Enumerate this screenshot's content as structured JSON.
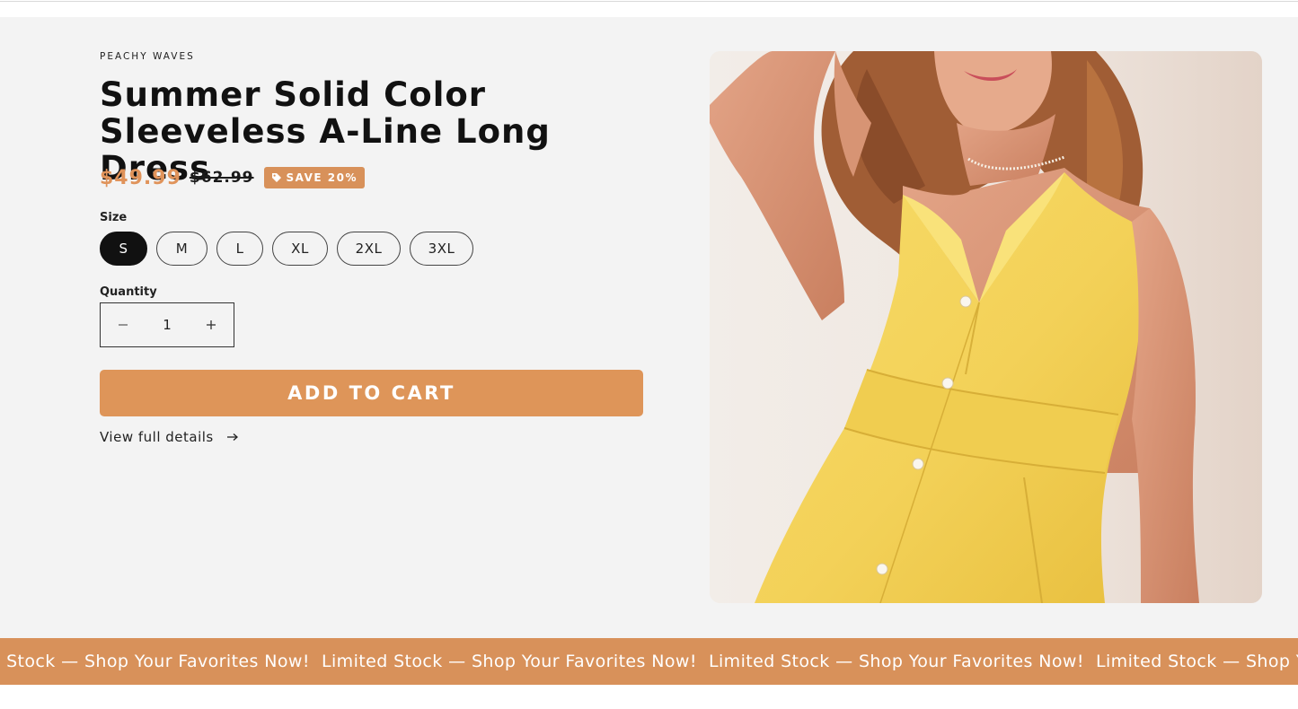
{
  "product": {
    "vendor": "PEACHY WAVES",
    "title": "Summer Solid Color Sleeveless A-Line Long Dress",
    "price_sale": "$49.99",
    "price_compare": "$62.99",
    "save_badge": "SAVE 20%",
    "size_label": "Size",
    "sizes": [
      "S",
      "M",
      "L",
      "XL",
      "2XL",
      "3XL"
    ],
    "selected_size": "S",
    "quantity_label": "Quantity",
    "quantity": "1",
    "add_to_cart": "ADD TO CART",
    "view_details": "View full details"
  },
  "marquee": {
    "items": [
      "Limited Stock — Shop Your Favorites Now!",
      "Limited Stock — Shop Your Favorites Now!",
      "Limited Stock — Shop Your Favorites Now!",
      "Limited Stock — Shop Your Favorites Now!"
    ]
  },
  "icons": {
    "tag": "tag-icon",
    "minus": "minus-icon",
    "plus": "plus-icon",
    "arrow": "arrow-right-icon"
  },
  "colors": {
    "accent": "#de9559",
    "sale_price": "#e0935a",
    "selected_size_bg": "#111111",
    "section_bg": "#f3f3f3"
  }
}
